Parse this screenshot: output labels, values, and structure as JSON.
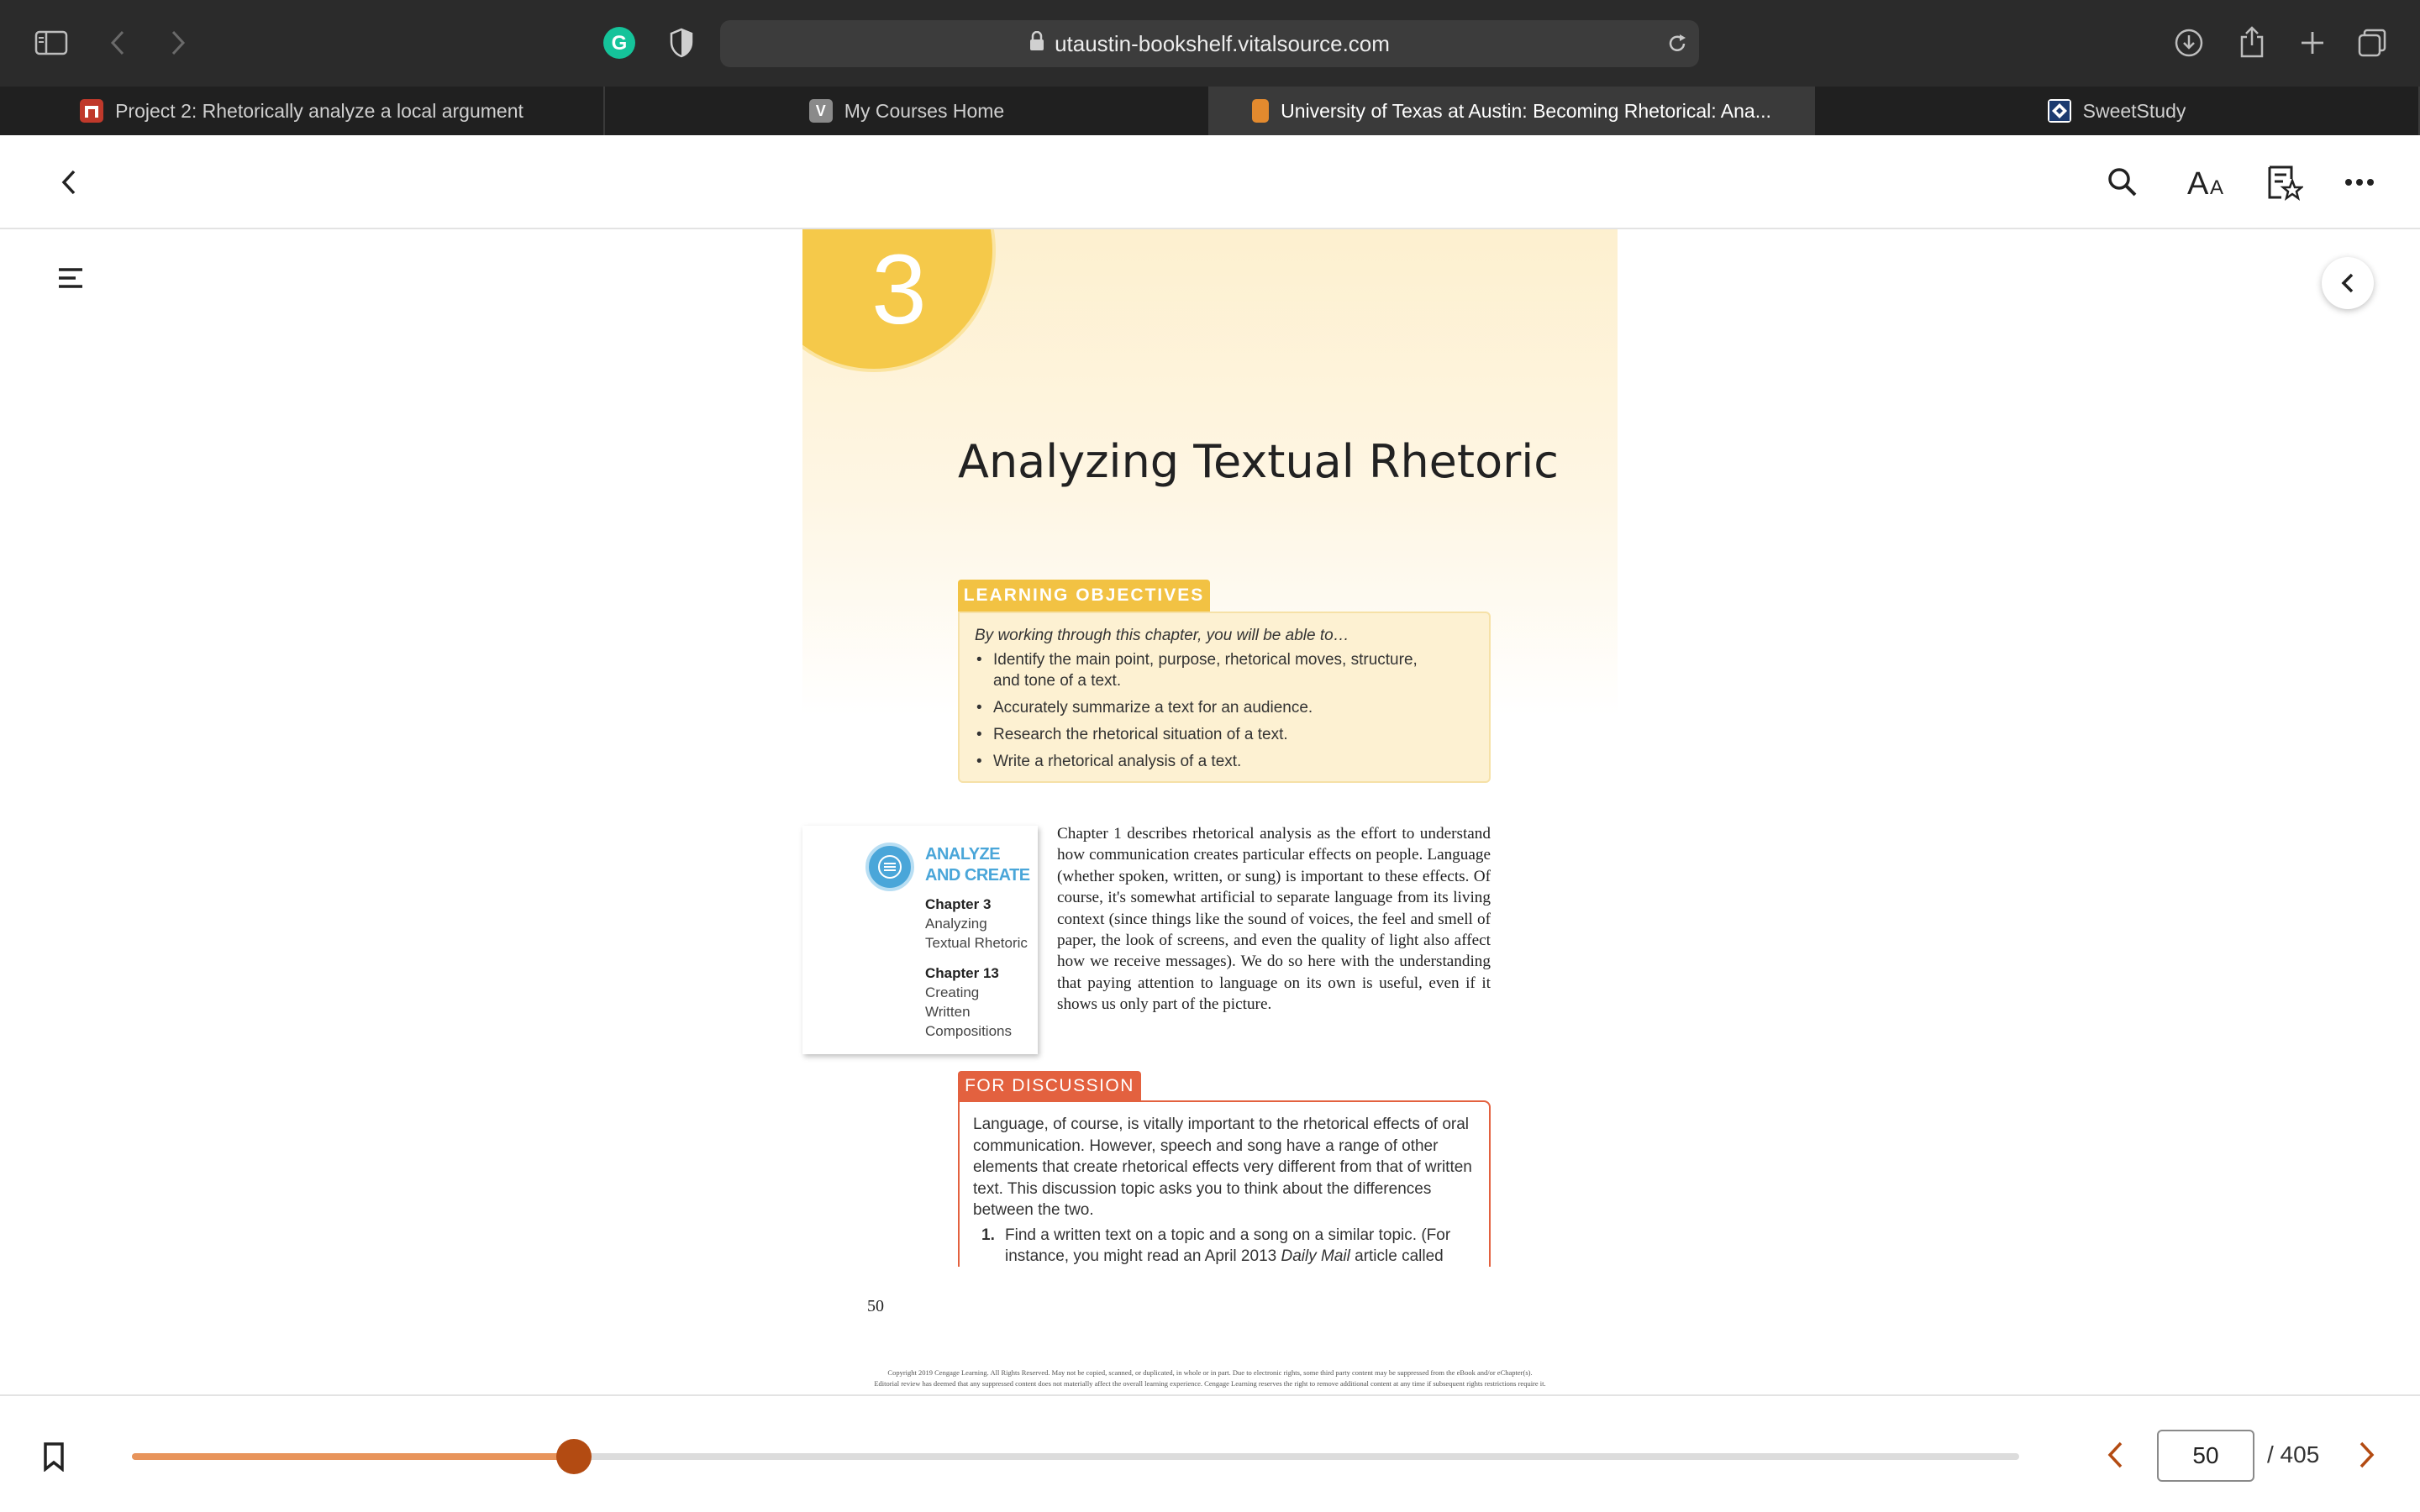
{
  "browser": {
    "url": "utaustin-bookshelf.vitalsource.com",
    "tabs": [
      {
        "title": "Project 2: Rhetorically analyze a local argument",
        "active": false
      },
      {
        "title": "My Courses Home",
        "favicon_letter": "V",
        "active": false
      },
      {
        "title": "University of Texas at Austin: Becoming Rhetorical: Ana...",
        "active": true
      },
      {
        "title": "SweetStudy",
        "active": false
      }
    ]
  },
  "page": {
    "chapter_number": "3",
    "chapter_title": "Analyzing Textual Rhetoric",
    "learning_objectives": {
      "label": "LEARNING OBJECTIVES",
      "intro": "By working through this chapter, you will be able to…",
      "items": [
        "Identify the main point, purpose, rhetorical moves, structure, and tone of a text.",
        "Accurately summarize a text for an audience.",
        "Research the rhetorical situation of a text.",
        "Write a rhetorical analysis of a text."
      ]
    },
    "analyze_create": {
      "title_line1": "ANALYZE",
      "title_line2": "AND CREATE",
      "ch1_heading": "Chapter 3",
      "ch1_line1": "Analyzing",
      "ch1_line2": "Textual Rhetoric",
      "ch2_heading": "Chapter 13",
      "ch2_line1": "Creating",
      "ch2_line2": "Written",
      "ch2_line3": "Compositions"
    },
    "body_paragraph": "Chapter 1 describes rhetorical analysis as the effort to understand how communication creates particular effects on people. Language (whether spoken, written, or sung) is important to these effects. Of course, it's somewhat artificial to separate language from its living context (since things like the sound of voices, the feel and smell of paper, the look of screens, and even the quality of light also affect how we receive messages). We do so here with the understanding that paying attention to language on its own is useful, even if it shows us only part of the picture.",
    "for_discussion": {
      "label": "FOR DISCUSSION",
      "text": "Language, of course, is vitally important to the rhetorical effects of oral communication. However, speech and song have a range of other elements that create rhetorical effects very different from that of written text. This discussion topic asks you to think about the differences between the two.",
      "item_number": "1.",
      "item_text_before": "Find a written text on a topic and a song on a similar topic. (For instance, you might read an April 2013 ",
      "item_text_italic": "Daily Mail",
      "item_text_after": " article called"
    },
    "page_number": "50",
    "copyright_line1": "Copyright 2019 Cengage Learning. All Rights Reserved. May not be copied, scanned, or duplicated, in whole or in part. Due to electronic rights, some third party content may be suppressed from the eBook and/or eChapter(s).",
    "copyright_line2": "Editorial review has deemed that any suppressed content does not materially affect the overall learning experience. Cengage Learning reserves the right to remove additional content at any time if subsequent rights restrictions require it."
  },
  "footer": {
    "current_page": "50",
    "total_pages": "/ 405",
    "progress": 0.234
  },
  "colors": {
    "accent": "#b34b12",
    "slider_fill": "#e8945b",
    "objectives": "#f2c243",
    "discussion": "#e3613f",
    "analyze": "#4aa6d9"
  }
}
